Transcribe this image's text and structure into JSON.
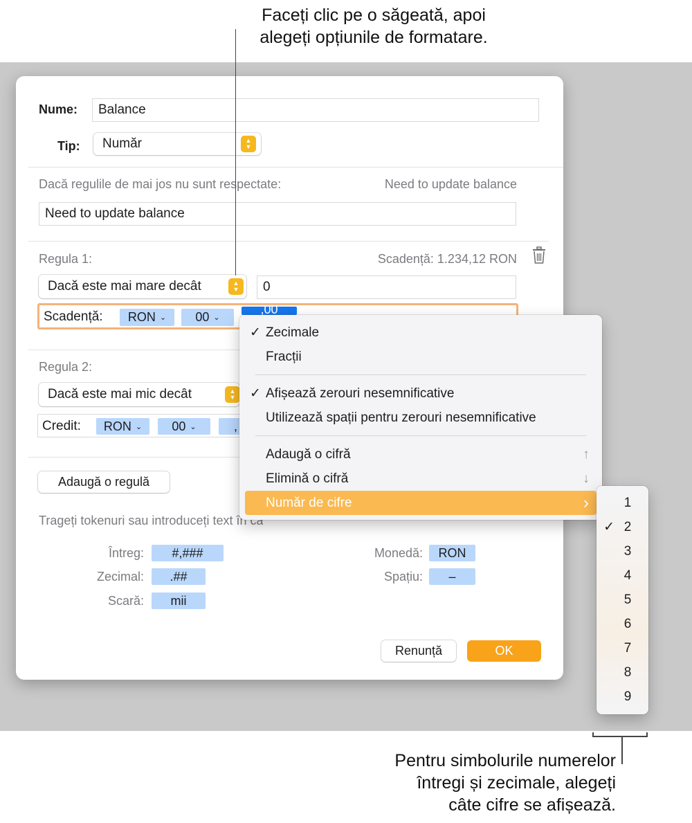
{
  "annotations": {
    "top_line1": "Faceți clic pe o săgeată, apoi",
    "top_line2": "alegeți opțiunile de formatare.",
    "bottom_line1": "Pentru simbolurile numerelor",
    "bottom_line2": "întregi și zecimale, alegeți",
    "bottom_line3": "câte cifre se afișează."
  },
  "dialog": {
    "name_label": "Nume:",
    "name_value": "Balance",
    "type_label": "Tip:",
    "type_value": "Număr",
    "fallback_label": "Dacă regulile de mai jos nu sunt respectate:",
    "fallback_preview": "Need to update balance",
    "fallback_value": "Need to update balance",
    "rule1": {
      "label": "Regula 1:",
      "preview": "Scadență: 1.234,12 RON",
      "condition": "Dacă este mai mare decât",
      "value": "0",
      "format_prefix": "Scadență:",
      "token_currency": "RON",
      "token_digits": "00",
      "token_selected": ",00"
    },
    "rule2": {
      "label": "Regula 2:",
      "condition": "Dacă este mai mic decât",
      "format_prefix": "Credit:",
      "token_currency": "RON",
      "token_digits": "00",
      "token_partial": ","
    },
    "add_rule_button": "Adaugă o regulă",
    "hint": "Trageți tokenuri sau introduceți text în câmpul de mai sus.",
    "tokens": {
      "integer_label": "Întreg:",
      "integer_token": "#,###",
      "decimal_label": "Zecimal:",
      "decimal_token": ".##",
      "scale_label": "Scară:",
      "scale_token": "mii",
      "currency_label": "Monedă:",
      "currency_token": "RON",
      "space_label": "Spațiu:",
      "space_token": "–"
    },
    "cancel_button": "Renunță",
    "ok_button": "OK"
  },
  "menu": {
    "decimals": "Zecimale",
    "fractions": "Fracții",
    "show_trailing_zeros": "Afișează zerouri nesemnificative",
    "use_spaces": "Utilizează spații pentru zerouri nesemnificative",
    "add_digit": "Adaugă o cifră",
    "add_digit_key": "↑",
    "remove_digit": "Elimină o cifră",
    "remove_digit_key": "↓",
    "num_digits": "Număr de cifre",
    "submenu_arrow": "›",
    "checkmark": "✓"
  },
  "submenu": {
    "items": [
      "1",
      "2",
      "3",
      "4",
      "5",
      "6",
      "7",
      "8",
      "9"
    ],
    "selected": "2"
  },
  "colors": {
    "accent": "#f9a31a",
    "token": "#b9d6fb",
    "token_selected": "#1677ee",
    "highlight": "#fbb951"
  }
}
